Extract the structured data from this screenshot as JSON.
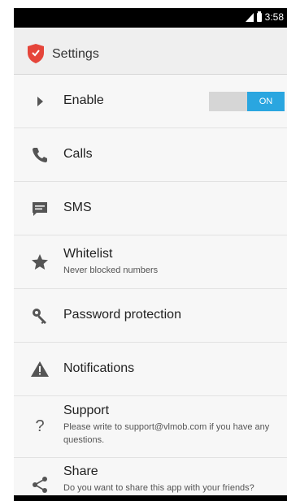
{
  "status_bar": {
    "time": "3:58"
  },
  "action_bar": {
    "title": "Settings"
  },
  "items": [
    {
      "id": "enable",
      "label": "Enable",
      "toggle": "ON"
    },
    {
      "id": "calls",
      "label": "Calls"
    },
    {
      "id": "sms",
      "label": "SMS"
    },
    {
      "id": "whitelist",
      "label": "Whitelist",
      "sub": "Never blocked numbers"
    },
    {
      "id": "password",
      "label": "Password protection"
    },
    {
      "id": "notifications",
      "label": "Notifications"
    },
    {
      "id": "support",
      "label": "Support",
      "sub": "Please write to support@vlmob.com if you have any questions."
    },
    {
      "id": "share",
      "label": "Share",
      "sub": "Do you want to share this app with your friends?"
    }
  ],
  "colors": {
    "accent": "#2aa6e0",
    "shield": "#e5453a"
  }
}
